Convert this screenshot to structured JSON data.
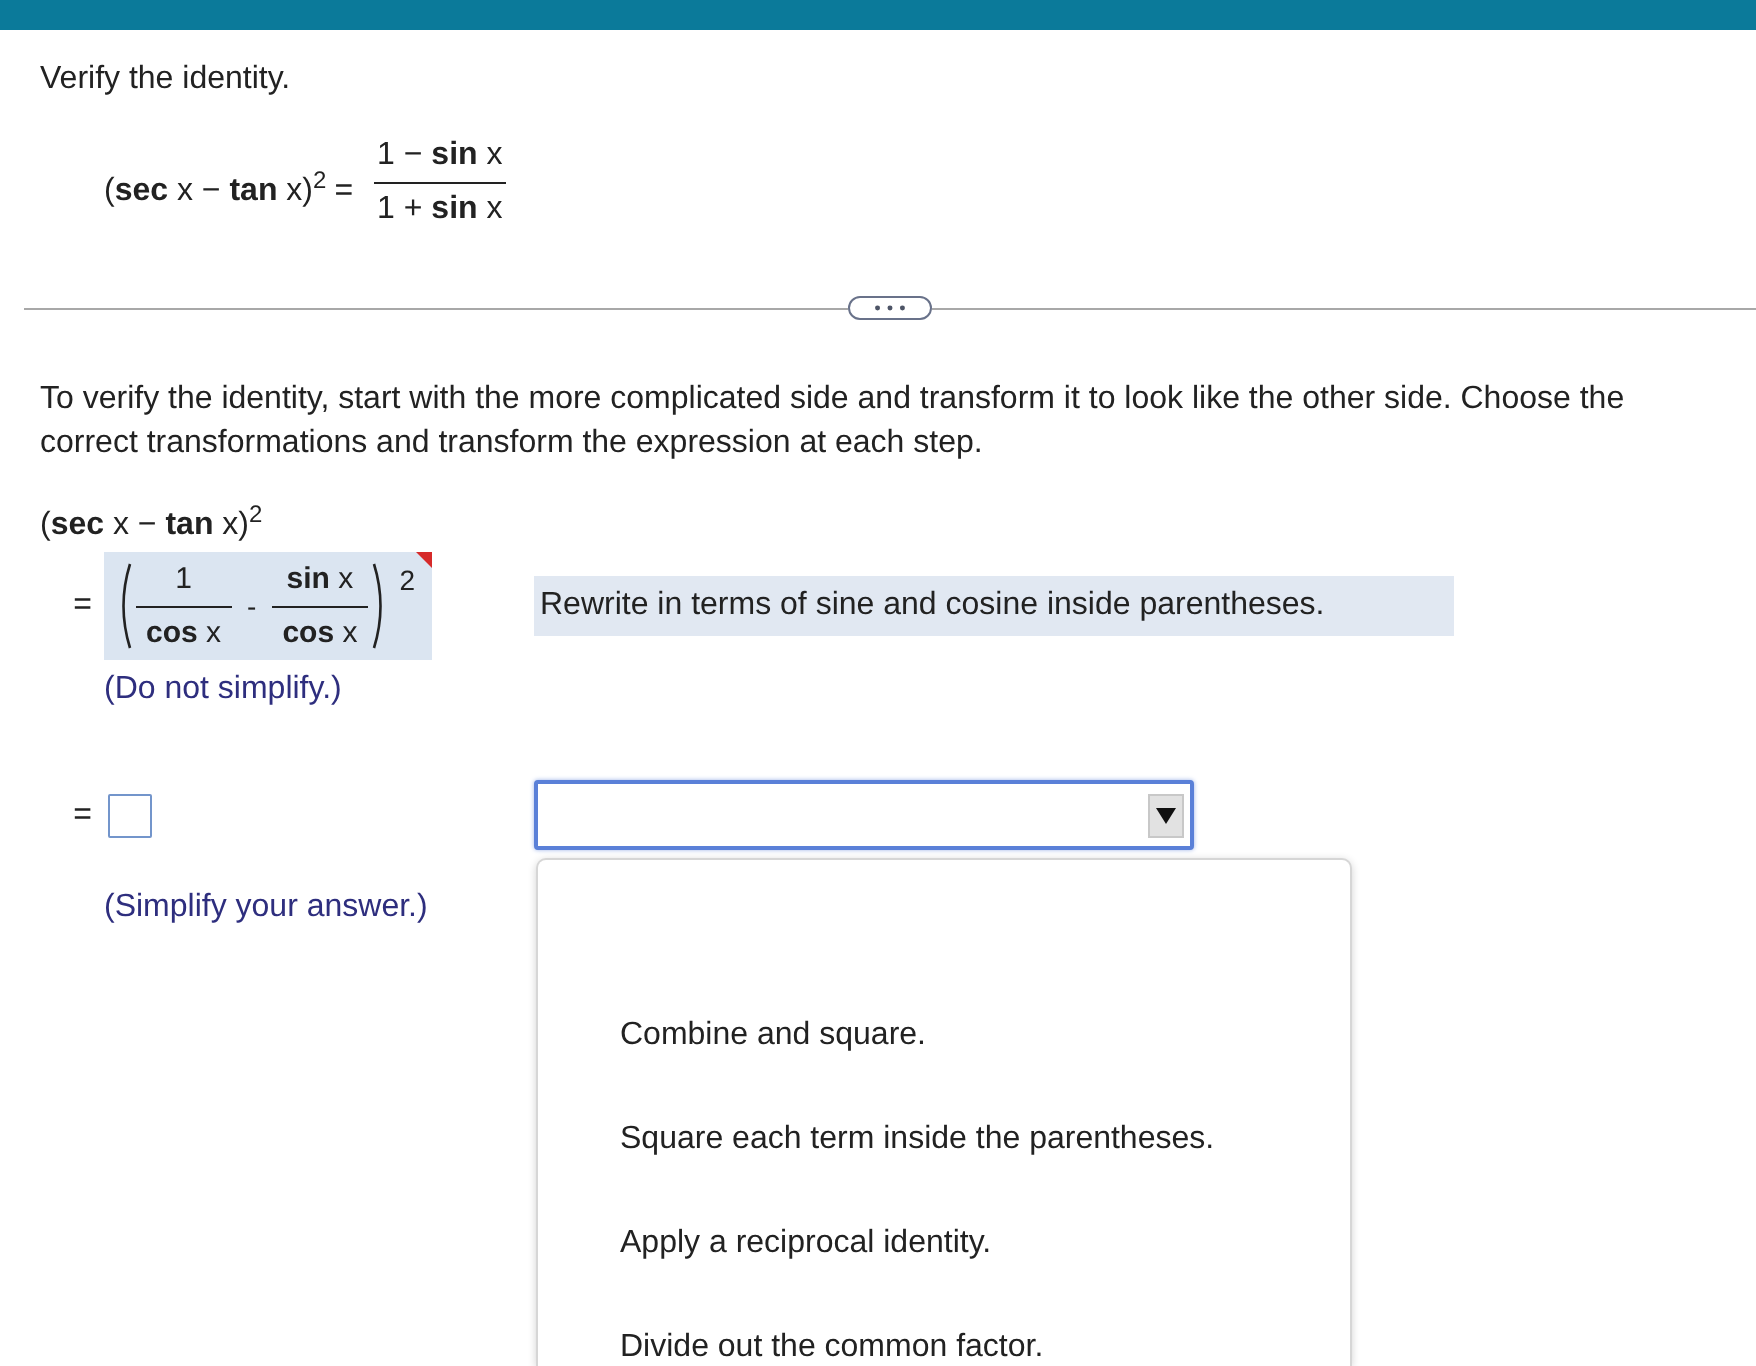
{
  "question": {
    "prompt": "Verify the identity.",
    "identity": {
      "left": "(**sec** x − **tan** x)$^{2}$",
      "equals": "=",
      "numerator": "1 − **sin** x",
      "denominator": "1 + **sin** x"
    }
  },
  "instructions": "To verify the identity, start with the more complicated side and transform it to look like the other side. Choose the correct transformations and transform the expression at each step.",
  "start": "(**sec** x − **tan** x)$^{2}$",
  "steps": [
    {
      "kind": "answered",
      "equals": "=",
      "expression": {
        "terms": [
          {
            "numerator": "1",
            "denominator": "**cos** x"
          },
          {
            "numerator": "**sin** x",
            "denominator": "**cos** x"
          }
        ],
        "operator": "-",
        "exponent": "2"
      },
      "corner_mark": true,
      "note": "(Do not simplify.)",
      "reason": {
        "kind": "text",
        "text": "Rewrite in terms of sine and cosine inside parentheses."
      }
    },
    {
      "kind": "blank",
      "equals": "=",
      "note": "(Simplify your answer.)",
      "reason": {
        "kind": "dropdown",
        "expanded": true,
        "options": [
          {
            "label": "Combine and square.",
            "selected": false
          },
          {
            "label": "Square each term inside the parentheses.",
            "selected": false
          },
          {
            "label": "Apply a reciprocal identity.",
            "selected": false
          },
          {
            "label": "Divide out the common factor.",
            "selected": false
          }
        ]
      }
    }
  ]
}
